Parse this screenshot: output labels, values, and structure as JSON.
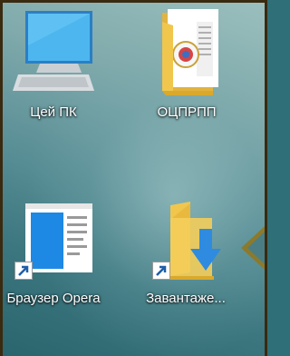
{
  "desktop": {
    "icons": [
      {
        "label": "Цей ПК",
        "icon": "computer-monitor-icon",
        "shortcut": false
      },
      {
        "label": "ОЦПРПП",
        "icon": "folder-with-documents-icon",
        "shortcut": false
      },
      {
        "label": "Браузер Opera",
        "icon": "browser-window-icon",
        "shortcut": true
      },
      {
        "label": "Завантаже...",
        "icon": "downloads-folder-icon",
        "shortcut": true
      }
    ]
  },
  "colors": {
    "monitor_screen": "#4db6ef",
    "folder": "#f1c64d",
    "download_arrow": "#2e8be0",
    "pointer_arrow": "#8c7a2c"
  }
}
